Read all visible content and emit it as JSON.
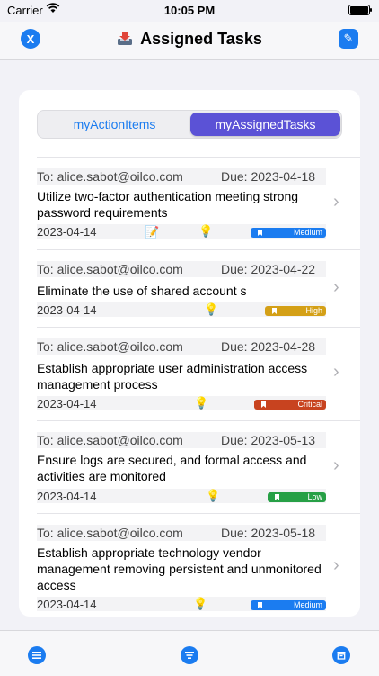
{
  "status": {
    "carrier": "Carrier",
    "time": "10:05 PM"
  },
  "nav": {
    "title": "Assigned Tasks",
    "left_btn": "X",
    "right_btn": "✎"
  },
  "segments": [
    "myActionItems",
    "myAssignedTasks"
  ],
  "tasks": [
    {
      "to": "To: alice.sabot@oilco.com",
      "due": "Due: 2023-04-18",
      "title": "Utilize two-factor authentication meeting strong password requirements",
      "date": "2023-04-14",
      "note": "📝",
      "priority": "Medium",
      "color": "#1b7cf0"
    },
    {
      "to": "To: alice.sabot@oilco.com",
      "due": "Due: 2023-04-22",
      "title": "Eliminate the use of shared account s",
      "date": "2023-04-14",
      "note": "",
      "priority": "High",
      "color": "#d4a017"
    },
    {
      "to": "To: alice.sabot@oilco.com",
      "due": "Due: 2023-04-28",
      "title": "Establish appropriate user administration access management process",
      "date": "2023-04-14",
      "note": "",
      "priority": "Critical",
      "color": "#c8431f"
    },
    {
      "to": "To: alice.sabot@oilco.com",
      "due": "Due: 2023-05-13",
      "title": "Ensure logs are secured, and formal access and activities are monitored",
      "date": "2023-04-14",
      "note": "",
      "priority": "Low",
      "color": "#27a046"
    },
    {
      "to": "To: alice.sabot@oilco.com",
      "due": "Due: 2023-05-18",
      "title": "Establish appropriate technology vendor management removing persistent and unmonitored access",
      "date": "2023-04-14",
      "note": "",
      "priority": "Medium",
      "color": "#1b7cf0"
    }
  ],
  "tabs": [
    {
      "icon": "list-icon"
    },
    {
      "icon": "filter-icon"
    },
    {
      "icon": "archive-icon"
    }
  ]
}
